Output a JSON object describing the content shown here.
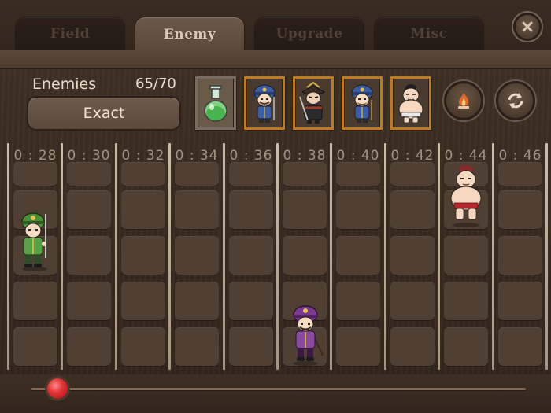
{
  "tabs": [
    {
      "label": "Field",
      "active": false
    },
    {
      "label": "Enemy",
      "active": true
    },
    {
      "label": "Upgrade",
      "active": false
    },
    {
      "label": "Misc",
      "active": false
    }
  ],
  "controls": {
    "enemies_label": "Enemies",
    "enemies_count": "65/70",
    "exact_label": "Exact"
  },
  "palette": [
    {
      "name": "green-potion",
      "icon": "potion-icon"
    },
    {
      "name": "blue-soldier",
      "icon": "blue-soldier-icon"
    },
    {
      "name": "samurai-general",
      "icon": "samurai-icon"
    },
    {
      "name": "blue-soldier-bearded",
      "icon": "blue-soldier-icon"
    },
    {
      "name": "sumo-wrestler",
      "icon": "sumo-icon"
    }
  ],
  "action_buttons": [
    {
      "name": "fire-button",
      "icon": "fire-icon"
    },
    {
      "name": "refresh-button",
      "icon": "refresh-icon"
    }
  ],
  "timeline": {
    "times": [
      "0 : 28",
      "0 : 30",
      "0 : 32",
      "0 : 34",
      "0 : 36",
      "0 : 38",
      "0 : 40",
      "0 : 42",
      "0 : 44",
      "0 : 46"
    ],
    "slider_value": 0.04
  },
  "placed_units": [
    {
      "type": "green-soldier",
      "time": "0 : 28",
      "lane": 2
    },
    {
      "type": "purple-soldier",
      "time": "0 : 38",
      "lane": 5
    },
    {
      "type": "sumo-wrestler",
      "time": "0 : 44",
      "lane": 1
    }
  ],
  "colors": {
    "active_tab_text": "#d9c9b4",
    "palette_border": "#c07a1c",
    "slider_knob": "#e23434"
  }
}
